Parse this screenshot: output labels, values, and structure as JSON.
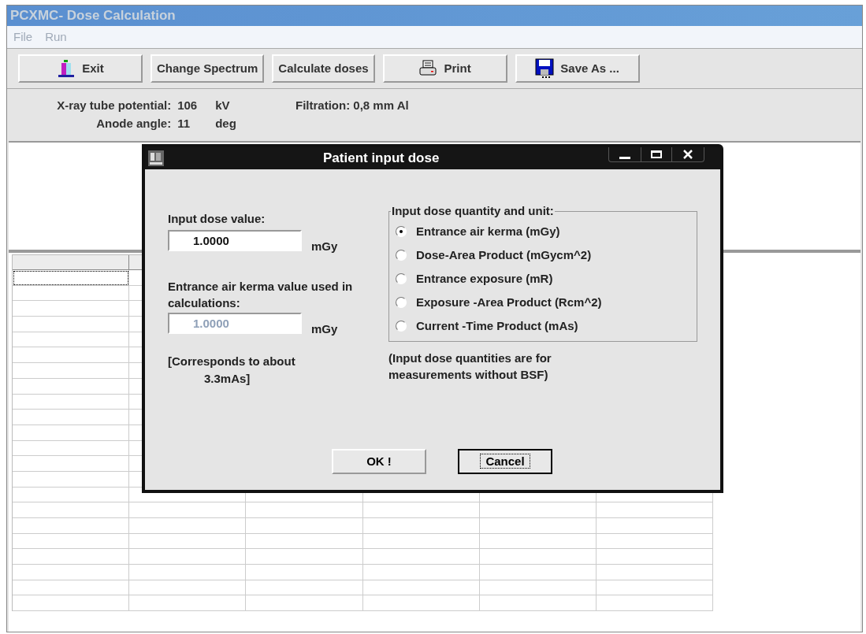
{
  "window": {
    "title": "PCXMC- Dose Calculation"
  },
  "menu": [
    {
      "label": "File",
      "disabled": true
    },
    {
      "label": "Run",
      "disabled": true
    }
  ],
  "toolbar": [
    {
      "label": "Exit",
      "kind": "exit"
    },
    {
      "label": "Change Spectrum",
      "kind": "text"
    },
    {
      "label": "Calculate doses",
      "kind": "text"
    },
    {
      "label": "Print",
      "kind": "print"
    },
    {
      "label": "Save As ...",
      "kind": "save"
    }
  ],
  "info": {
    "tube_potential_label": "X-ray tube potential:",
    "tube_potential": "106",
    "tube_potential_unit": "kV",
    "anode_label": "Anode angle:",
    "anode": "11",
    "anode_unit": "deg",
    "filtration": "Filtration: 0,8 mm Al"
  },
  "dialog": {
    "title": "Patient input dose",
    "input_label": "Input dose value:",
    "input_value": "1.0000",
    "input_unit": "mGy",
    "kerma_label": "Entrance air kerma value used in calculations:",
    "kerma_value": "1.0000",
    "kerma_disabled": true,
    "kerma_unit": "mGy",
    "corresponds": "[Corresponds to about",
    "corresponds_value": "3.3mAs]",
    "group_title": "Input dose quantity and unit:",
    "options": [
      {
        "label": "Entrance air kerma (mGy)",
        "selected": true
      },
      {
        "label": "Dose-Area Product (mGycm^2)",
        "selected": false
      },
      {
        "label": "Entrance exposure (mR)",
        "selected": false
      },
      {
        "label": "Exposure -Area Product (Rcm^2)",
        "selected": false
      },
      {
        "label": "Current -Time Product (mAs)",
        "selected": false
      }
    ],
    "note": "(Input dose quantities are for measurements without BSF)",
    "buttons": [
      {
        "label": "OK !",
        "focused": false
      },
      {
        "label": "Cancel",
        "focused": true
      }
    ]
  }
}
